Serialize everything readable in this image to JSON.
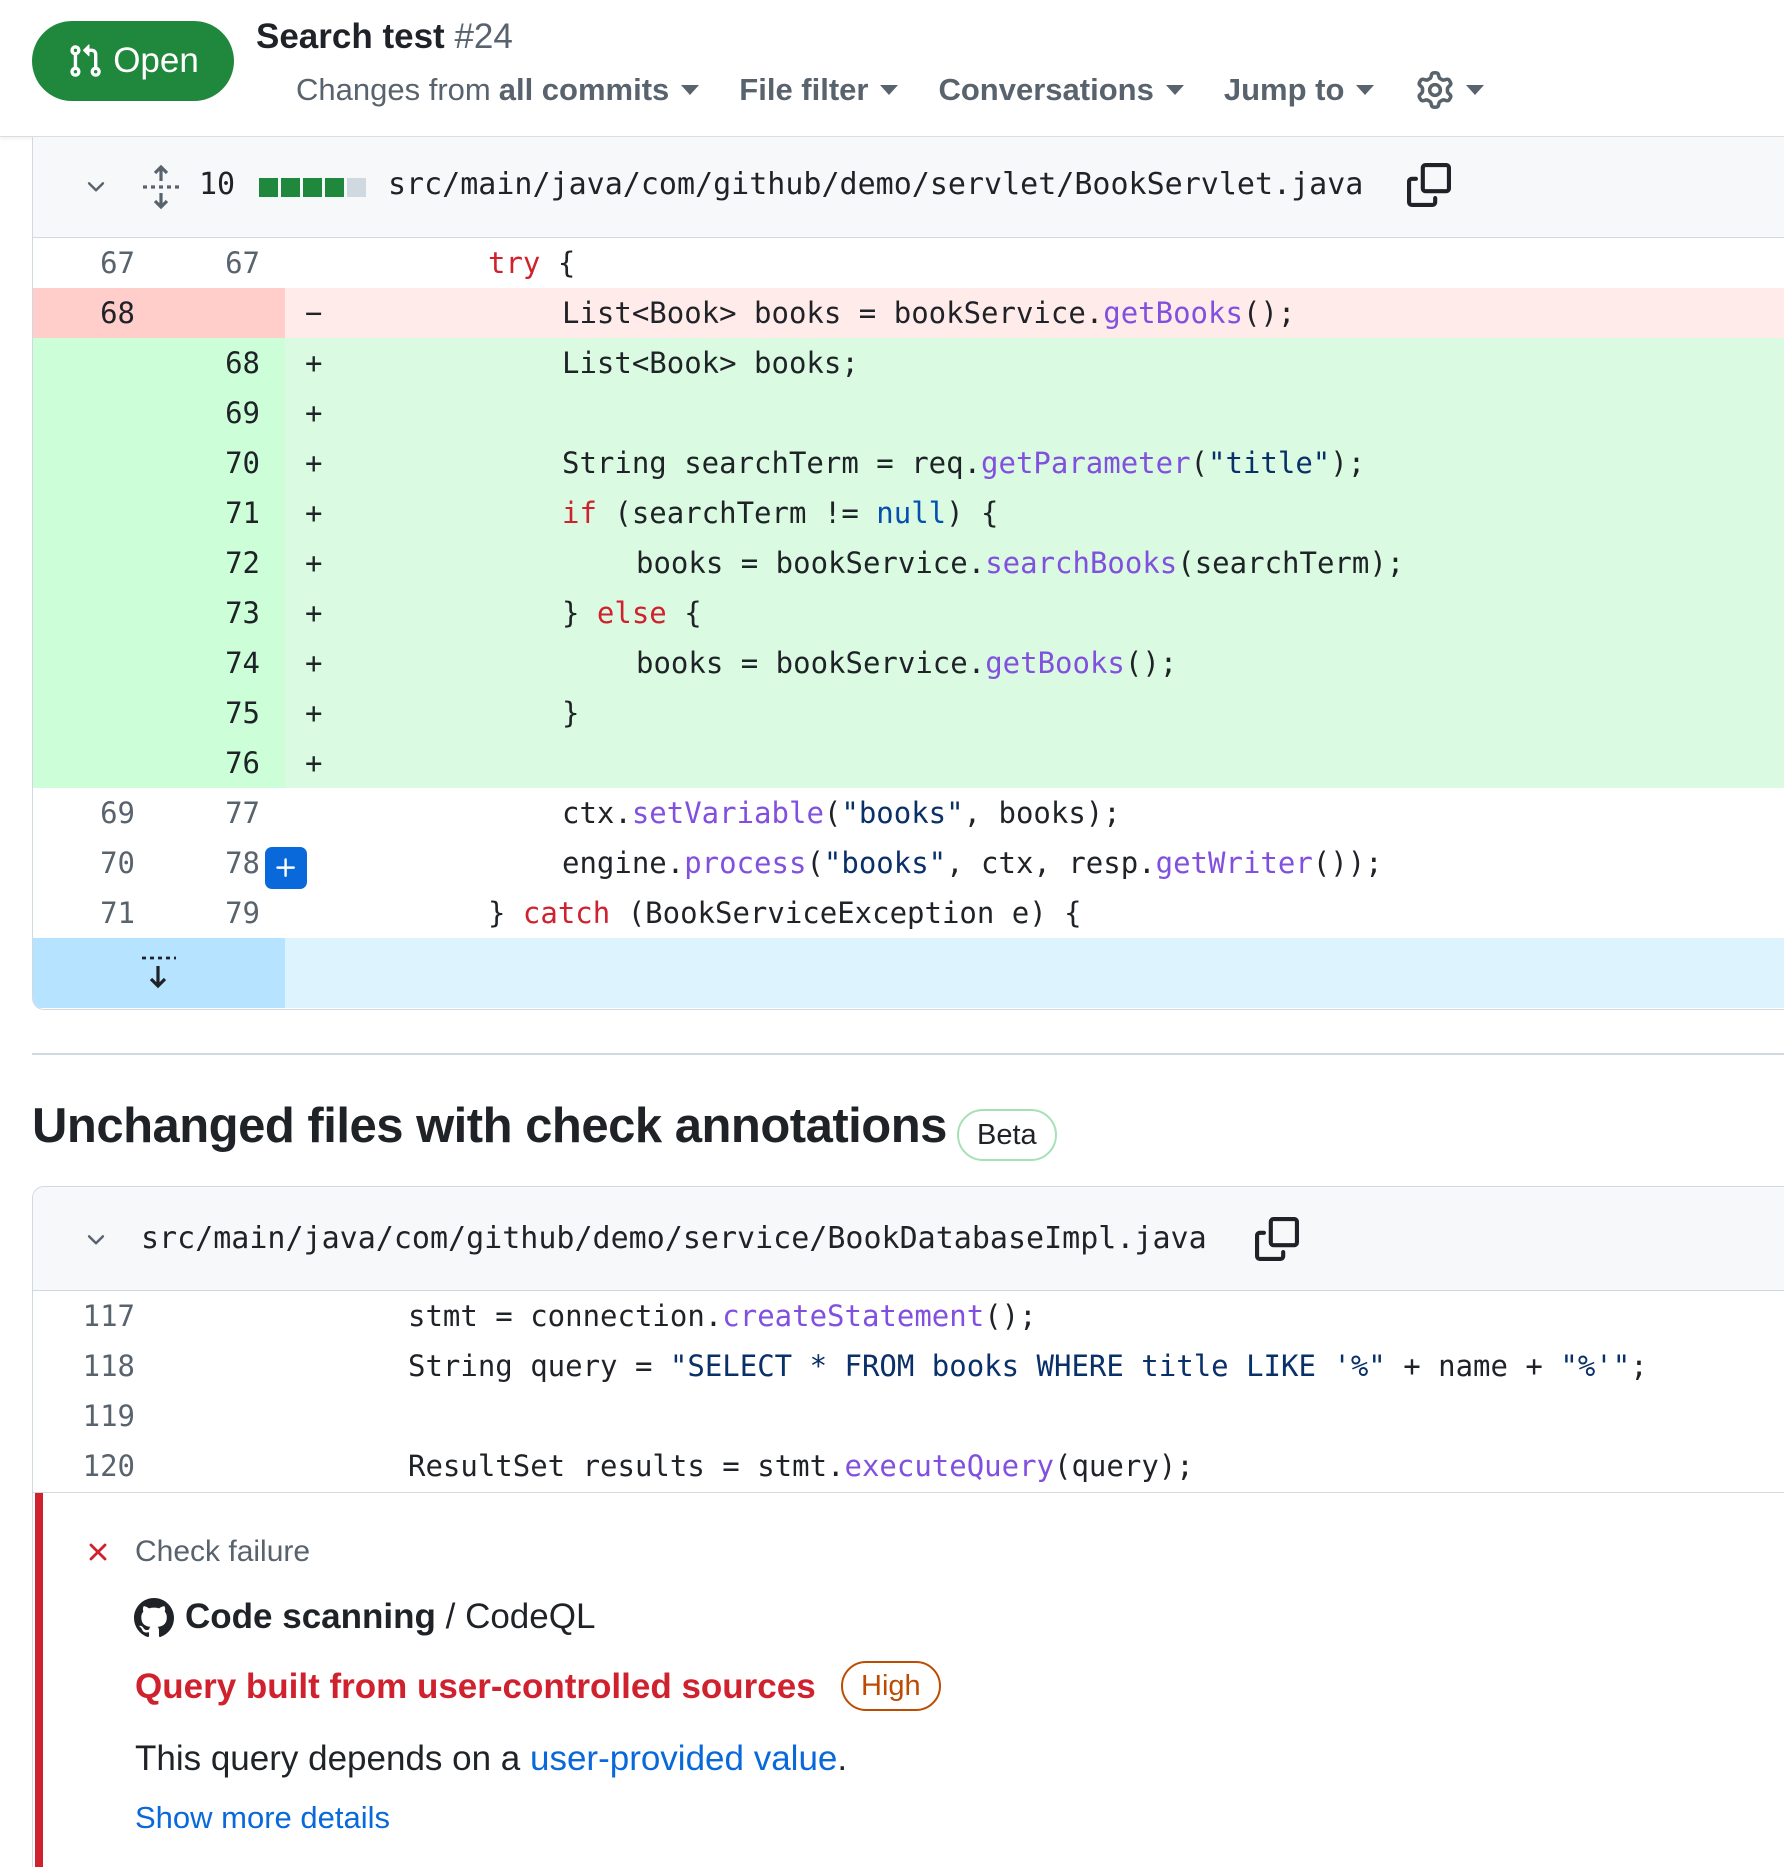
{
  "header": {
    "status_label": "Open",
    "title": "Search test",
    "number": "#24",
    "changes_prefix": "Changes from",
    "changes_value": "all commits",
    "file_filter": "File filter",
    "conversations": "Conversations",
    "jump_to": "Jump to"
  },
  "diff": {
    "changes_count": "10",
    "path": "src/main/java/com/github/demo/servlet/BookServlet.java",
    "stat_colors": [
      "#1f883d",
      "#1f883d",
      "#1f883d",
      "#1f883d",
      "#d1d9e0"
    ],
    "lines": [
      {
        "old": "67",
        "new": "67",
        "type": "ctx",
        "sign": ""
      },
      {
        "old": "68",
        "new": "",
        "type": "del",
        "sign": "−"
      },
      {
        "old": "",
        "new": "68",
        "type": "add",
        "sign": "+"
      },
      {
        "old": "",
        "new": "69",
        "type": "add",
        "sign": "+"
      },
      {
        "old": "",
        "new": "70",
        "type": "add",
        "sign": "+"
      },
      {
        "old": "",
        "new": "71",
        "type": "add",
        "sign": "+"
      },
      {
        "old": "",
        "new": "72",
        "type": "add",
        "sign": "+"
      },
      {
        "old": "",
        "new": "73",
        "type": "add",
        "sign": "+"
      },
      {
        "old": "",
        "new": "74",
        "type": "add",
        "sign": "+"
      },
      {
        "old": "",
        "new": "75",
        "type": "add",
        "sign": "+"
      },
      {
        "old": "",
        "new": "76",
        "type": "add",
        "sign": "+"
      },
      {
        "old": "69",
        "new": "77",
        "type": "ctx",
        "sign": ""
      },
      {
        "old": "70",
        "new": "78",
        "type": "ctx",
        "sign": ""
      },
      {
        "old": "71",
        "new": "79",
        "type": "ctx",
        "sign": ""
      }
    ]
  },
  "unchanged": {
    "heading": "Unchanged files with check annotations",
    "beta": "Beta",
    "path": "src/main/java/com/github/demo/service/BookDatabaseImpl.java",
    "line_numbers": [
      "117",
      "118",
      "119",
      "120"
    ],
    "annotation": {
      "status": "Check failure",
      "tool": "Code scanning",
      "separator": " / ",
      "engine": "CodeQL",
      "title": "Query built from user-controlled sources",
      "severity": "High",
      "desc_prefix": "This query depends on a ",
      "desc_link": "user-provided value",
      "desc_suffix": ".",
      "more": "Show more details"
    }
  }
}
